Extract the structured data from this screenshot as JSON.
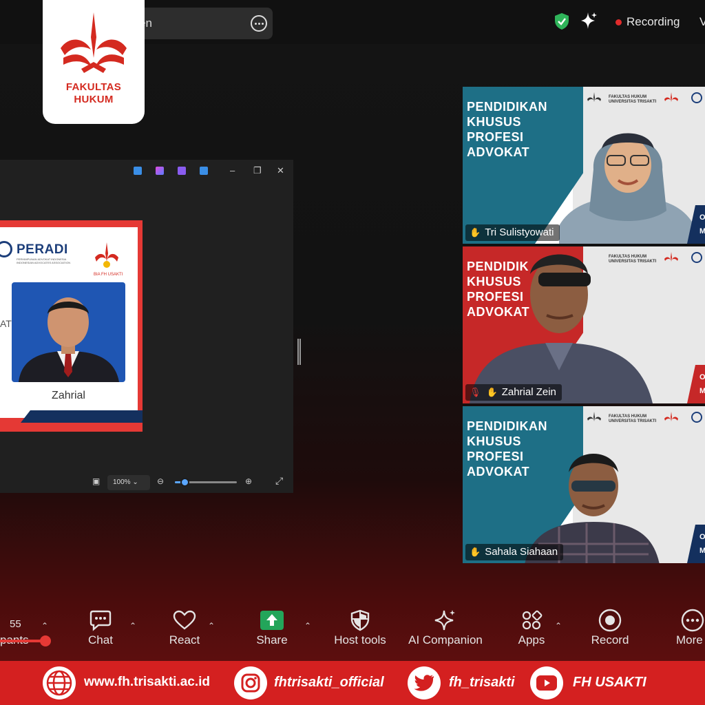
{
  "top_bar": {
    "meeting_title_partial": "en",
    "recording_label": "Recording",
    "right_edge_char": "V"
  },
  "logo": {
    "line1": "FAKULTAS",
    "line2": "HUKUM",
    "color": "#d42a20"
  },
  "shared_window": {
    "zoom_level": "100%",
    "slide": {
      "org_name": "PERADI",
      "org_subtitle": "PERHIMPUNAN ADVOKAT INDONESIA INDONESIAN ADVOCATES ASSOCIATION",
      "partner_label": "BIA FH USAKTI",
      "speaker_name": "Zahrial",
      "partial_text": "AT"
    },
    "controls": {
      "minimize": "–",
      "restore": "❐",
      "close": "✕"
    }
  },
  "participants": [
    {
      "name": "Tri Sulistyowati",
      "banner_title": [
        "PENDIDIKAN",
        "KHUSUS",
        "PROFESI",
        "ADVOKAT"
      ],
      "banner_color": "#1e6f86",
      "header_text": "FAKULTAS HUKUM UNIVERSITAS TRISAKTI",
      "corner_text": [
        "O",
        "M"
      ],
      "muted": false,
      "active_speaker": false
    },
    {
      "name": "Zahrial Zein",
      "banner_title": [
        "PENDIDIK",
        "KHUSUS",
        "PROFESI",
        "ADVOKAT"
      ],
      "banner_color": "#c62828",
      "header_text": "FAKULTAS HUKUM UNIVERSITAS TRISAKTI",
      "corner_text": [
        "O",
        "M"
      ],
      "muted": true,
      "active_speaker": false
    },
    {
      "name": "Sahala Siahaan",
      "banner_title": [
        "PENDIDIKAN",
        "KHUSUS",
        "PROFESI",
        "ADVOKAT"
      ],
      "banner_color": "#1e6f86",
      "header_text": "FAKULTAS HUKUM UNIVERSITAS TRISAKTI",
      "corner_text": [
        "O",
        "M"
      ],
      "muted": false,
      "active_speaker": true
    }
  ],
  "toolbar": {
    "participants_count": "55",
    "participants_label": "pants",
    "chat_label": "Chat",
    "react_label": "React",
    "share_label": "Share",
    "host_tools_label": "Host tools",
    "ai_companion_label": "AI Companion",
    "apps_label": "Apps",
    "record_label": "Record",
    "more_label": "More"
  },
  "footer": {
    "website": "www.fh.trisakti.ac.id",
    "instagram": "fhtrisakti_official",
    "twitter": "fh_trisakti",
    "youtube": "FH USAKTI",
    "background": "#d42020"
  }
}
